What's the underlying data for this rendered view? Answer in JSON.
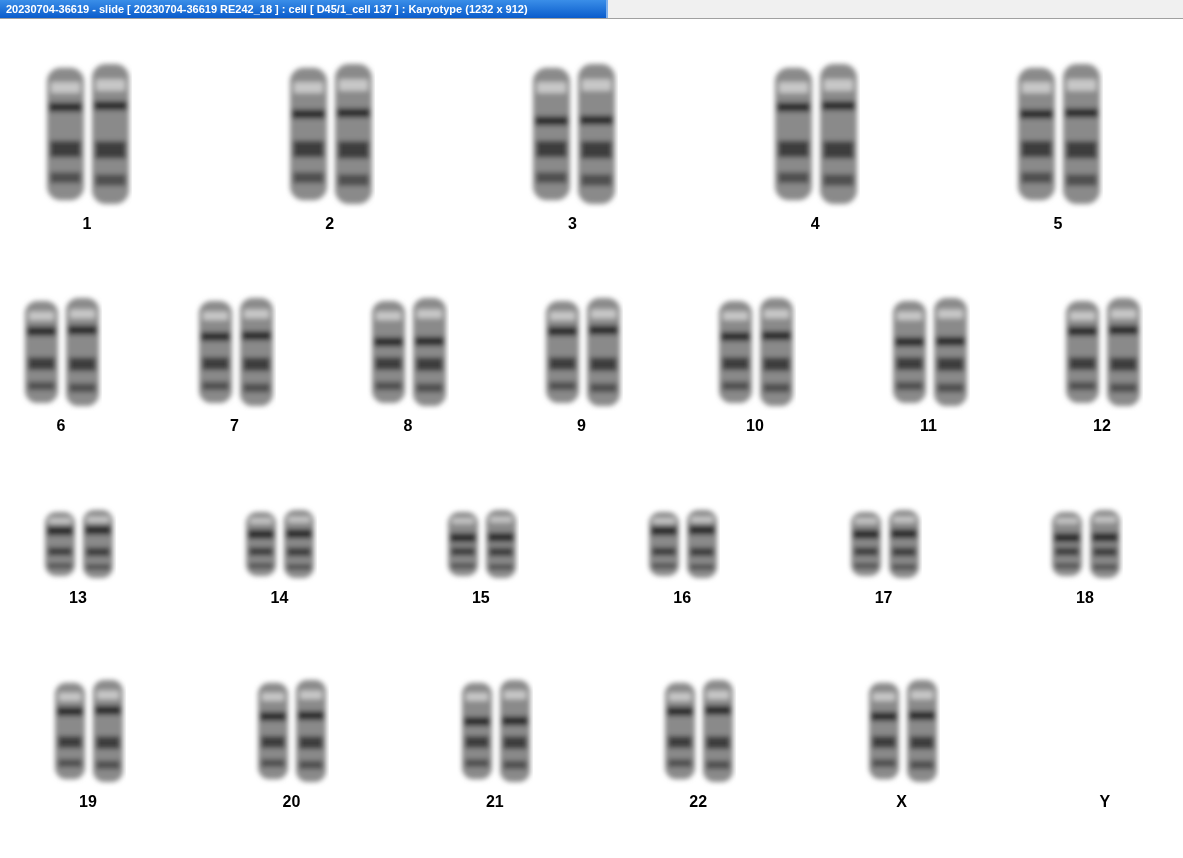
{
  "window": {
    "title": "20230704-36619 - slide [ 20230704-36619 RE242_18 ] : cell [ D45/1_cell 137 ] : Karyotype  (1232 x 912)"
  },
  "karyotype": {
    "rows": [
      {
        "items": [
          {
            "label": "1",
            "kind": "pair"
          },
          {
            "label": "2",
            "kind": "pair"
          },
          {
            "label": "3",
            "kind": "pair"
          },
          {
            "label": "4",
            "kind": "pair"
          },
          {
            "label": "5",
            "kind": "pair"
          }
        ]
      },
      {
        "items": [
          {
            "label": "6",
            "kind": "pair"
          },
          {
            "label": "7",
            "kind": "pair"
          },
          {
            "label": "8",
            "kind": "pair"
          },
          {
            "label": "9",
            "kind": "pair"
          },
          {
            "label": "10",
            "kind": "pair"
          },
          {
            "label": "11",
            "kind": "pair"
          },
          {
            "label": "12",
            "kind": "pair"
          }
        ]
      },
      {
        "items": [
          {
            "label": "13",
            "kind": "pair"
          },
          {
            "label": "14",
            "kind": "pair"
          },
          {
            "label": "15",
            "kind": "pair"
          },
          {
            "label": "16",
            "kind": "pair"
          },
          {
            "label": "17",
            "kind": "pair"
          },
          {
            "label": "18",
            "kind": "pair"
          }
        ]
      },
      {
        "items": [
          {
            "label": "19",
            "kind": "pair"
          },
          {
            "label": "20",
            "kind": "pair"
          },
          {
            "label": "21",
            "kind": "pair"
          },
          {
            "label": "22",
            "kind": "pair"
          },
          {
            "label": "X",
            "kind": "pair"
          },
          {
            "label": "Y",
            "kind": "none"
          }
        ]
      }
    ]
  }
}
